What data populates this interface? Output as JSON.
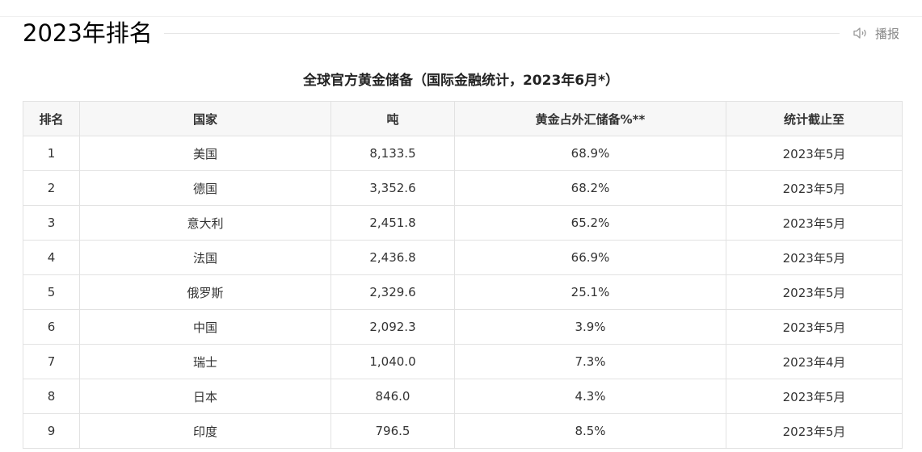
{
  "header": {
    "title": "2023年排名",
    "broadcast_label": "播报",
    "broadcast_icon": "speaker-icon"
  },
  "table": {
    "caption": "全球官方黄金储备（国际金融统计，2023年6月*）",
    "columns": [
      "排名",
      "国家",
      "吨",
      "黄金占外汇储备%**",
      "统计截止至"
    ],
    "rows": [
      [
        "1",
        "美国",
        "8,133.5",
        "68.9%",
        "2023年5月"
      ],
      [
        "2",
        "德国",
        "3,352.6",
        "68.2%",
        "2023年5月"
      ],
      [
        "3",
        "意大利",
        "2,451.8",
        "65.2%",
        "2023年5月"
      ],
      [
        "4",
        "法国",
        "2,436.8",
        "66.9%",
        "2023年5月"
      ],
      [
        "5",
        "俄罗斯",
        "2,329.6",
        "25.1%",
        "2023年5月"
      ],
      [
        "6",
        "中国",
        "2,092.3",
        "3.9%",
        "2023年5月"
      ],
      [
        "7",
        "瑞士",
        "1,040.0",
        "7.3%",
        "2023年4月"
      ],
      [
        "8",
        "日本",
        "846.0",
        "4.3%",
        "2023年5月"
      ],
      [
        "9",
        "印度",
        "796.5",
        "8.5%",
        "2023年5月"
      ]
    ]
  },
  "colors": {
    "header_bg": "#f7f7f7",
    "border": "#e2e2e2",
    "muted_text": "#888888"
  }
}
